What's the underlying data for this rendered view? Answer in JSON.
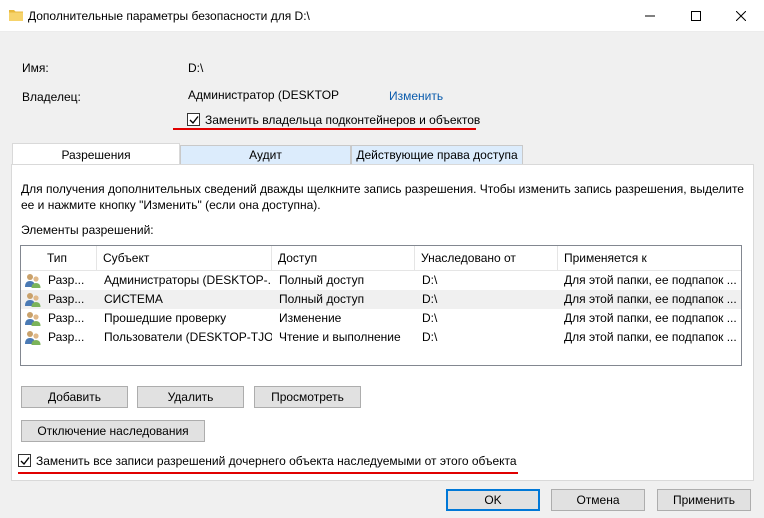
{
  "window": {
    "title": "Дополнительные параметры безопасности  для  D:\\"
  },
  "info": {
    "name_label": "Имя:",
    "name_value": "D:\\",
    "owner_label": "Владелец:",
    "owner_value": "Администратор (DESKTOP",
    "change_link": "Изменить",
    "replace_owner_checkbox": {
      "label": "Заменить владельца подконтейнеров и объектов",
      "checked": true
    }
  },
  "tabs": [
    {
      "label": "Разрешения",
      "active": true
    },
    {
      "label": "Аудит",
      "active": false
    },
    {
      "label": "Действующие права доступа",
      "active": false
    }
  ],
  "permissions": {
    "hint_line1": "Для получения дополнительных сведений дважды щелкните запись разрешения. Чтобы изменить запись разрешения, выделите",
    "hint_line2": "ее и нажмите кнопку \"Изменить\" (если она доступна).",
    "entries_label": "Элементы разрешений:",
    "columns": [
      "Тип",
      "Субъект",
      "Доступ",
      "Унаследовано от",
      "Применяется к"
    ],
    "rows": [
      {
        "type": "Разр...",
        "principal": "Администраторы (DESKTOP-...",
        "access": "Полный доступ",
        "inherited": "D:\\",
        "applies": "Для этой папки, ее подпапок ...",
        "selected": false,
        "icon": "users-icon"
      },
      {
        "type": "Разр...",
        "principal": "СИСТЕМА",
        "access": "Полный доступ",
        "inherited": "D:\\",
        "applies": "Для этой папки, ее подпапок ...",
        "selected": true,
        "icon": "users-icon"
      },
      {
        "type": "Разр...",
        "principal": "Прошедшие проверку",
        "access": "Изменение",
        "inherited": "D:\\",
        "applies": "Для этой папки, ее подпапок ...",
        "selected": false,
        "icon": "users-icon"
      },
      {
        "type": "Разр...",
        "principal": "Пользователи (DESKTOP-TJO...",
        "access": "Чтение и выполнение",
        "inherited": "D:\\",
        "applies": "Для этой папки, ее подпапок ...",
        "selected": false,
        "icon": "users-icon"
      }
    ],
    "buttons": {
      "add": "Добавить",
      "remove": "Удалить",
      "view": "Просмотреть",
      "disable_inheritance": "Отключение наследования"
    },
    "replace_child_checkbox": {
      "label": "Заменить все записи разрешений дочернего объекта наследуемыми от этого объекта",
      "checked": true
    }
  },
  "footer": {
    "ok": "OK",
    "cancel": "Отмена",
    "apply": "Применить"
  },
  "colors": {
    "accent": "#0078d7",
    "highlight": "#e00000",
    "link": "#0b5cad"
  }
}
